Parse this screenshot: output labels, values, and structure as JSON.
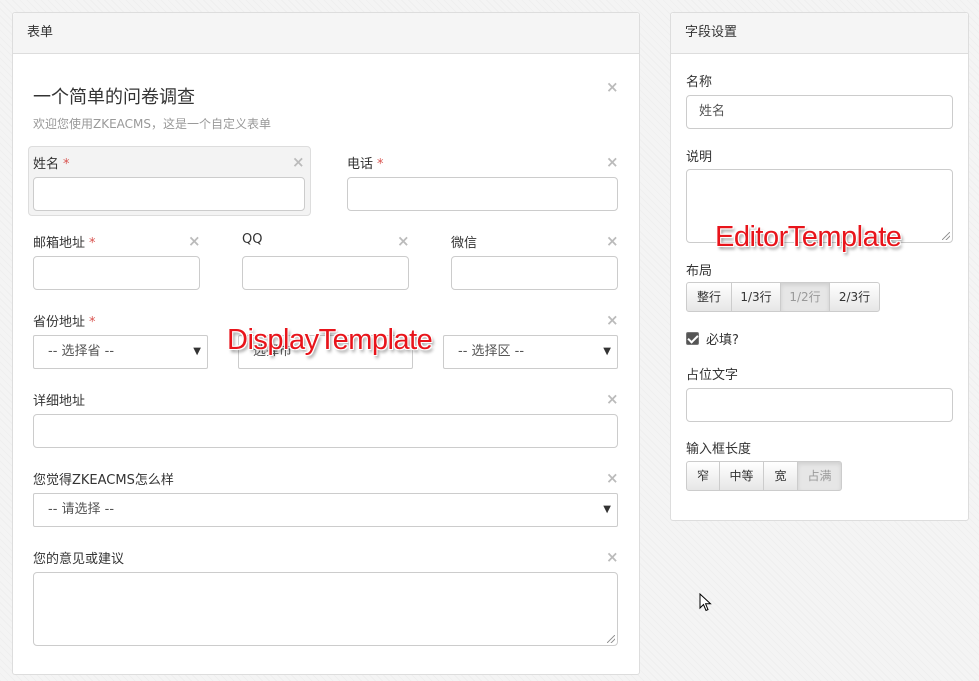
{
  "form_panel": {
    "heading": "表单",
    "title": "一个简单的问卷调查",
    "subtitle": "欢迎您使用ZKEACMS，这是一个自定义表单",
    "close_glyph": "×",
    "required_mark": "*",
    "fields": {
      "name": {
        "label": "姓名",
        "required": true
      },
      "phone": {
        "label": "电话",
        "required": true
      },
      "email": {
        "label": "邮箱地址",
        "required": true
      },
      "qq": {
        "label": "QQ",
        "required": false
      },
      "wechat": {
        "label": "微信",
        "required": false
      },
      "province": {
        "label": "省份地址",
        "required": true,
        "select_province": "-- 选择省 --",
        "select_city_partial": "选择市",
        "select_district": "-- 选择区 --"
      },
      "address": {
        "label": "详细地址",
        "required": false
      },
      "opinion_select": {
        "label": "您觉得ZKEACMS怎么样",
        "selected": "-- 请选择 --"
      },
      "suggestion": {
        "label": "您的意见或建议"
      }
    }
  },
  "field_settings": {
    "heading": "字段设置",
    "name_label": "名称",
    "name_value": "姓名",
    "description_label": "说明",
    "layout_label": "布局",
    "layout_options": [
      "整行",
      "1/3行",
      "1/2行",
      "2/3行"
    ],
    "layout_active": "1/2行",
    "required_label": "必填?",
    "required_checked": true,
    "placeholder_label": "占位文字",
    "input_width_label": "输入框长度",
    "width_options": [
      "窄",
      "中等",
      "宽",
      "占满"
    ],
    "width_active": "占满"
  },
  "annotations": {
    "display": "DisplayTemplate",
    "editor": "EditorTemplate"
  },
  "colors": {
    "required": "#d9534f",
    "annotation": "#e8141b",
    "panel_heading_bg": "#f5f5f5"
  }
}
